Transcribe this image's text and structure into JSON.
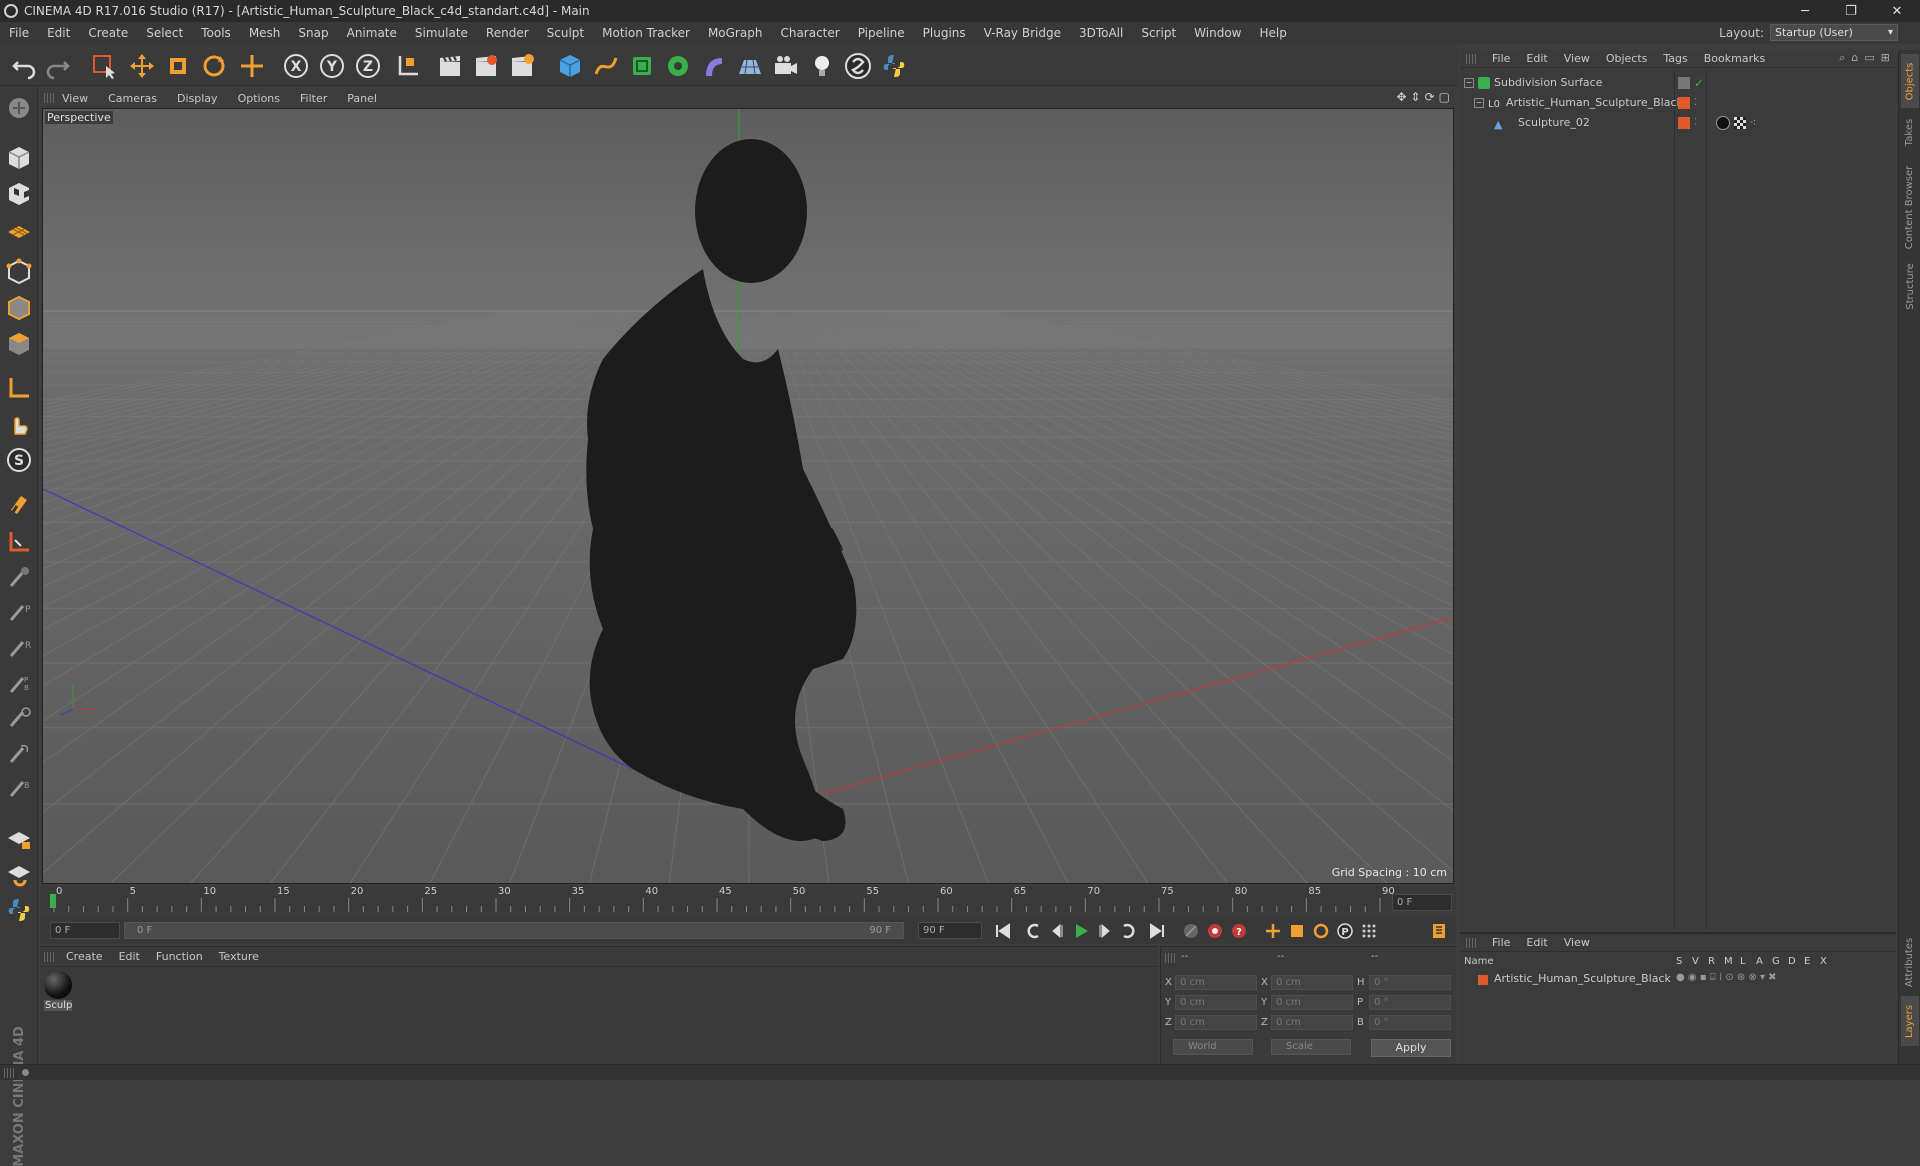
{
  "window": {
    "title": "CINEMA 4D R17.016 Studio (R17) - [Artistic_Human_Sculpture_Black_c4d_standart.c4d] - Main",
    "minimize": "─",
    "restore": "❐",
    "close": "✕"
  },
  "menubar": {
    "items": [
      "File",
      "Edit",
      "Create",
      "Select",
      "Tools",
      "Mesh",
      "Snap",
      "Animate",
      "Simulate",
      "Render",
      "Sculpt",
      "Motion Tracker",
      "MoGraph",
      "Character",
      "Pipeline",
      "Plugins",
      "V-Ray Bridge",
      "3DToAll",
      "Script",
      "Window",
      "Help"
    ],
    "layout_label": "Layout:",
    "layout_value": "Startup (User)"
  },
  "viewport": {
    "menu": [
      "View",
      "Cameras",
      "Display",
      "Options",
      "Filter",
      "Panel"
    ],
    "label": "Perspective",
    "grid_spacing": "Grid Spacing : 10 cm"
  },
  "timeline": {
    "ticks": [
      "0",
      "5",
      "10",
      "15",
      "20",
      "25",
      "30",
      "35",
      "40",
      "45",
      "50",
      "55",
      "60",
      "65",
      "70",
      "75",
      "80",
      "85",
      "90"
    ],
    "current_frame": "0 F",
    "start_field": "0 F",
    "range_start": "0 F",
    "range_end": "90 F",
    "end_field": "90 F"
  },
  "material_panel": {
    "menu": [
      "Create",
      "Edit",
      "Function",
      "Texture"
    ],
    "materials": [
      {
        "label": "Sculp"
      }
    ]
  },
  "coords": {
    "header": [
      "--",
      "--",
      "--"
    ],
    "rows": [
      {
        "axis": "X",
        "pos": "0 cm",
        "axis2": "X",
        "size": "0 cm",
        "rot_label": "H",
        "rot": "0 °"
      },
      {
        "axis": "Y",
        "pos": "0 cm",
        "axis2": "Y",
        "size": "0 cm",
        "rot_label": "P",
        "rot": "0 °"
      },
      {
        "axis": "Z",
        "pos": "0 cm",
        "axis2": "Z",
        "size": "0 cm",
        "rot_label": "B",
        "rot": "0 °"
      }
    ],
    "mode": "World",
    "scale": "Scale",
    "apply": "Apply"
  },
  "object_manager": {
    "menu": [
      "File",
      "Edit",
      "View",
      "Objects",
      "Tags",
      "Bookmarks"
    ],
    "objects": [
      {
        "name": "Subdivision Surface"
      },
      {
        "name": "Artistic_Human_Sculpture_Black"
      },
      {
        "name": "Sculpture_02"
      }
    ]
  },
  "layer_manager": {
    "menu": [
      "File",
      "Edit",
      "View"
    ],
    "columns": [
      "Name",
      "S",
      "V",
      "R",
      "M",
      "L",
      "A",
      "G",
      "D",
      "E",
      "X"
    ],
    "layers": [
      {
        "name": "Artistic_Human_Sculpture_Black"
      }
    ]
  },
  "right_tabs": [
    "Objects",
    "Takes",
    "Content Browser",
    "Structure",
    "Attributes",
    "Layers"
  ],
  "branding": "MAXON CINEMA 4D",
  "colors": {
    "accent": "#e8a13a",
    "axis_x": "#c03a3a",
    "axis_y": "#2fa02f",
    "axis_z": "#3a3ac0",
    "sculpture": "#1c1c1c"
  }
}
